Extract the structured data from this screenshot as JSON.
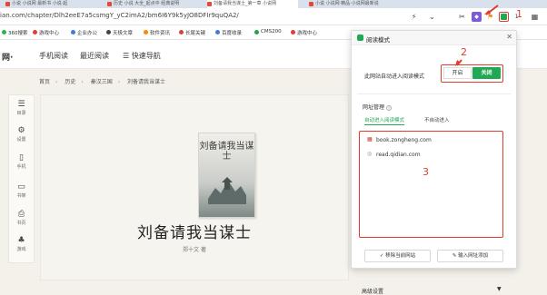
{
  "tabs": [
    {
      "label": "小说 小说网 最新书 小说·起"
    },
    {
      "label": "历史 小说 大全_起点中 经典说明"
    },
    {
      "label": "刘备请我当谋士_第一章 小说网"
    },
    {
      "label": "小说 小说网·精品·小说网最新说"
    }
  ],
  "address": {
    "url": "ian.com/chapter/Dlh2eeE7a5csmgY_yC2imA2/bm6I6Y9k5yJO8DFIr9quQA2/"
  },
  "toolbar": {
    "icons": [
      "star-icon",
      "share-icon",
      "cut-icon",
      "extension-icon",
      "flag-icon",
      "reader-icon",
      "apps-icon"
    ],
    "colors": {
      "reader": "#21a855",
      "flag": "#f08a24",
      "extension": "#7b5cd6"
    }
  },
  "bookmarks": [
    {
      "label": "360搜索",
      "color": "#2db34a"
    },
    {
      "label": "游戏中心",
      "color": "#e53a35"
    },
    {
      "label": "企业办公",
      "color": "#3a7be0"
    },
    {
      "label": "天极文章",
      "color": "#444444"
    },
    {
      "label": "软件资讯",
      "color": "#ff8800"
    },
    {
      "label": "长尾关键",
      "color": "#d6433b"
    },
    {
      "label": "百度收录",
      "color": "#3a7be0"
    },
    {
      "label": "CMS200",
      "color": "#29a04b"
    },
    {
      "label": "游戏中心",
      "color": "#e53a35"
    }
  ],
  "site": {
    "logo_fragment": "网·",
    "nav": [
      "手机阅读",
      "最近阅读",
      "快速导航"
    ]
  },
  "breadcrumb": [
    "首页",
    "历史",
    "秦汉三国",
    "刘备请我当谋士"
  ],
  "sidemenu": [
    {
      "label": "目录",
      "icon": "list-icon"
    },
    {
      "label": "设置",
      "icon": "settings-icon"
    },
    {
      "label": "手机",
      "icon": "phone-icon"
    },
    {
      "label": "书架",
      "icon": "bookshelf-icon"
    },
    {
      "label": "书页",
      "icon": "book-page-icon"
    },
    {
      "label": "游戏",
      "icon": "game-icon"
    }
  ],
  "book": {
    "cover_title": "刘备请我当谋士",
    "title": "刘备请我当谋士",
    "author": "郑十文 著"
  },
  "popup": {
    "title": "阅读模式",
    "auto_label": "此网站自动进入阅读模式",
    "btn_on": "开启",
    "btn_off": "关闭",
    "section_title": "网址管理",
    "tab_auto": "自动进入阅读模式",
    "tab_never": "不自动进入",
    "sites": [
      "book.zongheng.com",
      "read.qidian.com"
    ],
    "remove_btn": "移除当前网站",
    "add_btn": "输入网址添加",
    "advanced": "高级设置"
  },
  "annotations": {
    "n1": "1",
    "n2": "2",
    "n3": "3",
    "color": "#e23b2e"
  }
}
